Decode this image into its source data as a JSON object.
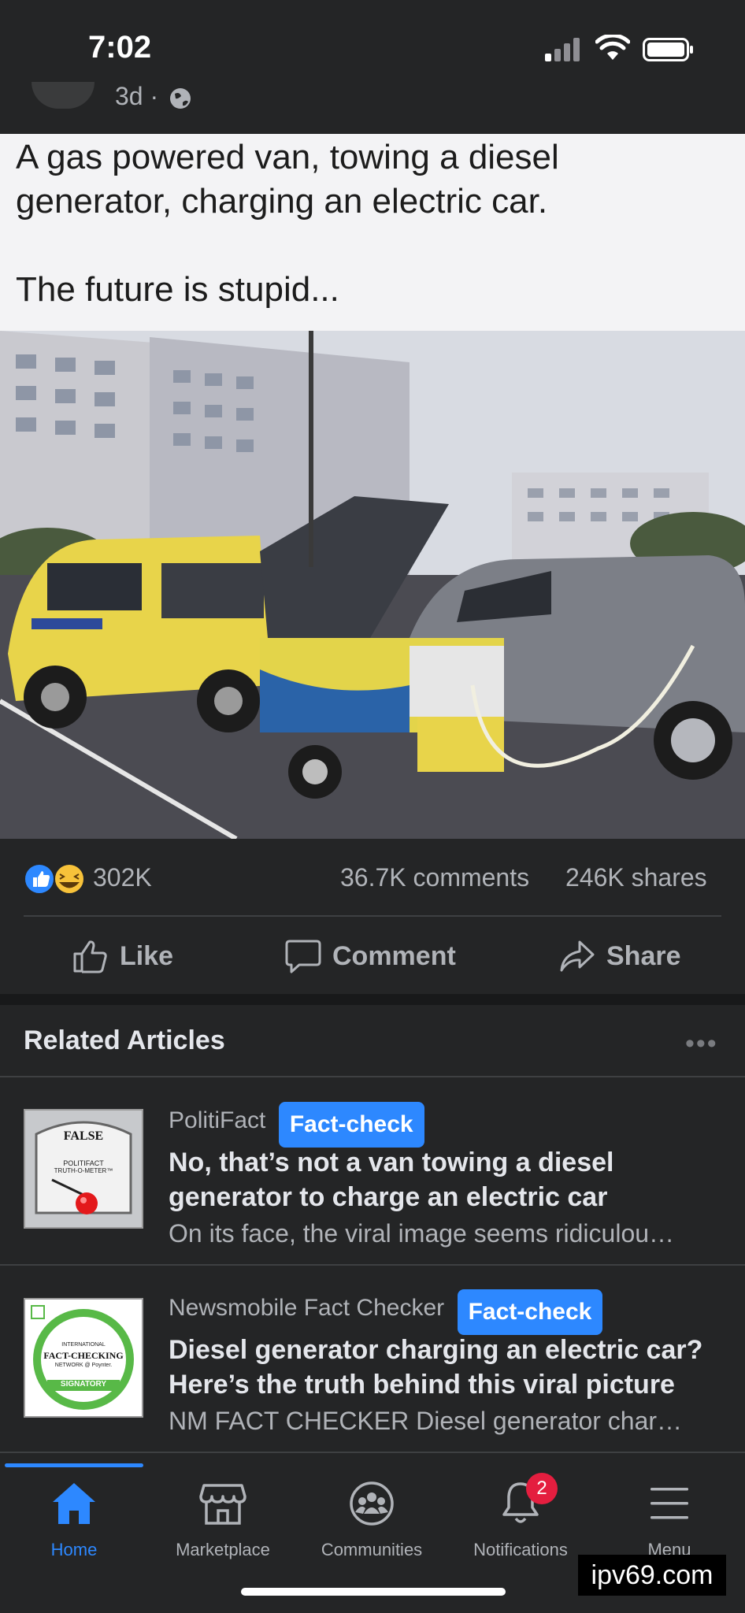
{
  "status_bar": {
    "time": "7:02"
  },
  "post": {
    "meta": "3d ·",
    "caption_line1": "A gas powered van, towing a diesel",
    "caption_line2": "generator, charging an electric car.",
    "caption_line3": "The future is stupid..."
  },
  "reactions": {
    "count": "302K",
    "comments": "36.7K comments",
    "shares": "246K shares"
  },
  "actions": {
    "like": "Like",
    "comment": "Comment",
    "share": "Share"
  },
  "related": {
    "title": "Related Articles",
    "articles": [
      {
        "source": "PolitiFact",
        "badge": "Fact-check",
        "headline": "No, that’s not a van towing a diesel generator to charge an electric car",
        "snippet": "On its face, the viral image seems ridiculou…",
        "thumb_label": "FALSE",
        "thumb_sub1": "POLITIFACT",
        "thumb_sub2": "TRUTH-O-METER™"
      },
      {
        "source": "Newsmobile Fact Checker",
        "badge": "Fact-check",
        "headline": "Diesel generator charging an electric car? Here’s the truth behind this viral picture",
        "snippet": "NM FACT CHECKER Diesel generator char…",
        "thumb_label": "FACT-CHECKING",
        "thumb_sub1": "INTERNATIONAL",
        "thumb_sub2": "NETWORK @ Poynter.",
        "thumb_sub3": "SIGNATORY"
      }
    ]
  },
  "nav": {
    "items": [
      "Home",
      "Marketplace",
      "Communities",
      "Notifications",
      "Menu"
    ],
    "notif_count": "2"
  },
  "watermark": "ipv69.com",
  "colors": {
    "accent": "#2d88ff",
    "background": "#242526",
    "badge_red": "#e41e3f"
  }
}
